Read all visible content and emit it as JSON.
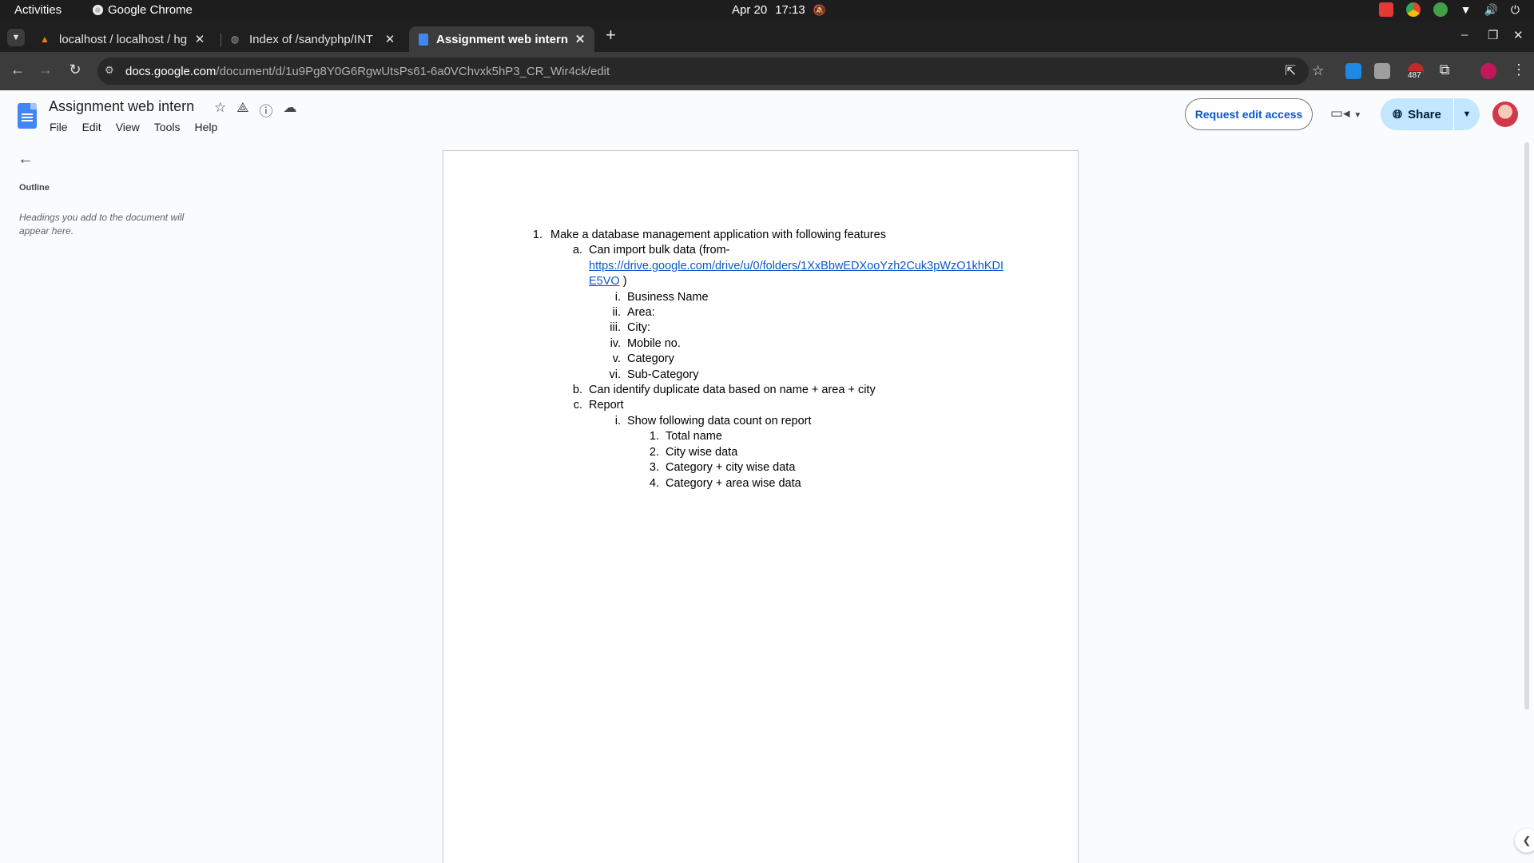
{
  "os": {
    "activities": "Activities",
    "app_name": "Google Chrome",
    "date": "Apr 20",
    "time": "17:13"
  },
  "tabs": [
    {
      "title": "localhost / localhost / hg",
      "icon": "phpmyadmin-icon",
      "active": false
    },
    {
      "title": "Index of /sandyphp/INT",
      "icon": "globe-icon",
      "active": false
    },
    {
      "title": "Assignment web intern",
      "icon": "docs-icon",
      "active": true
    }
  ],
  "address_bar": {
    "domain": "docs.google.com",
    "path": "/document/d/1u9Pg8Y0G6RgwUtsPs61-6a0VChvxk5hP3_CR_Wir4ck/edit"
  },
  "extensions": {
    "badge_count": "487"
  },
  "docs": {
    "title": "Assignment web intern",
    "menu": [
      "File",
      "Edit",
      "View",
      "Tools",
      "Help"
    ],
    "request_edit_label": "Request edit access",
    "share_label": "Share"
  },
  "outline": {
    "title": "Outline",
    "hint": "Headings you add to the document will appear here."
  },
  "document": {
    "item1": {
      "marker": "1.",
      "text": "Make a database management application with following features"
    },
    "item1a": {
      "marker": "a.",
      "text": "Can import bulk data (from-",
      "link": "https://drive.google.com/drive/u/0/folders/1XxBbwEDXooYzh2Cuk3pWzO1khKDIE5VO",
      "suffix": " )"
    },
    "fields": [
      {
        "marker": "i.",
        "text": "Business Name"
      },
      {
        "marker": "ii.",
        "text": "Area:"
      },
      {
        "marker": "iii.",
        "text": "City:"
      },
      {
        "marker": "iv.",
        "text": "Mobile no."
      },
      {
        "marker": "v.",
        "text": "Category"
      },
      {
        "marker": "vi.",
        "text": "Sub-Category"
      }
    ],
    "item1b": {
      "marker": "b.",
      "text": "Can identify duplicate data based on name + area + city"
    },
    "item1c": {
      "marker": "c.",
      "text": "Report"
    },
    "report_i": {
      "marker": "i.",
      "text": "Show following data count on report"
    },
    "report_items": [
      {
        "marker": "1.",
        "text": "Total name"
      },
      {
        "marker": "2.",
        "text": "City wise data"
      },
      {
        "marker": "3.",
        "text": "Category + city wise data"
      },
      {
        "marker": "4.",
        "text": "Category + area wise data"
      }
    ]
  },
  "colors": {
    "link": "#1155cc",
    "share_bg": "#c2e7ff",
    "request_text": "#0b57d0",
    "docs_blue": "#4285f4"
  }
}
